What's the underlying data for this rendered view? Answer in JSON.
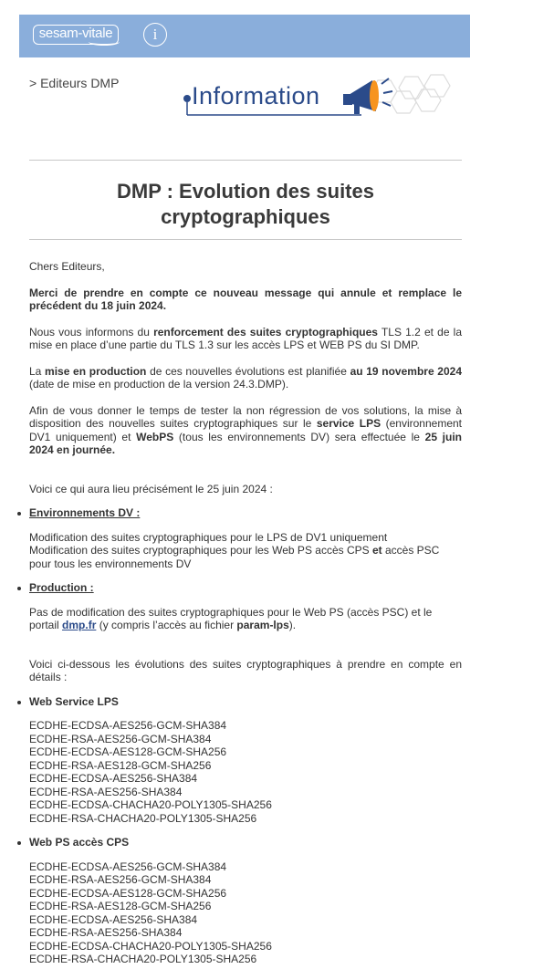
{
  "header": {
    "logo_text": "sesam-vitale",
    "info_icon": "i"
  },
  "breadcrumb": "> Editeurs DMP",
  "graphic": {
    "word": "Information",
    "icon": "megaphone-icon"
  },
  "title_line1": "DMP : Evolution des suites",
  "title_line2": "cryptographiques",
  "greeting": "Chers Editeurs,",
  "p1": "Merci de prendre en compte ce nouveau message qui annule et remplace le précédent du 18 juin 2024.",
  "p2": {
    "a": "Nous vous informons du ",
    "b": "renforcement des suites cryptographiques",
    "c": " TLS 1.2 et de la mise en place d’une partie du TLS 1.3 sur les accès LPS et WEB PS du SI DMP."
  },
  "p3": {
    "a": "La ",
    "b": "mise en production",
    "c": " de ces nouvelles évolutions est planifiée ",
    "d": "au 19 novembre 2024",
    "e": " (date de mise en production de la version 24.3.DMP)."
  },
  "p4": {
    "a": "Afin de vous donner le temps de tester la non régression de vos solutions, la mise à disposition des nouvelles suites cryptographiques sur le ",
    "b": "service LPS",
    "c": " (environnement DV1 uniquement) et ",
    "d": "WebPS",
    "e": " (tous les environnements DV) sera effectuée le ",
    "f": "25 juin 2024 en journée."
  },
  "p5": "Voici ce qui aura lieu précisément le 25 juin 2024 :",
  "section_dv": {
    "heading": "Environnements DV :",
    "line1": "Modification des suites cryptographiques pour le LPS de DV1 uniquement",
    "line2a": "Modification des suites cryptographiques pour les Web PS accès CPS ",
    "line2b": "et",
    "line2c": " accès PSC pour tous les environnements DV"
  },
  "section_prod": {
    "heading": "Production :",
    "a": "Pas de modification des suites cryptographiques pour le Web PS (accès PSC) et le portail ",
    "link": "dmp.fr",
    "b": " (y compris l’accès au fichier ",
    "c": "param-lps",
    "d": ")."
  },
  "p6": "Voici ci-dessous les évolutions des suites cryptographiques à prendre en compte en détails :",
  "lps": {
    "heading": "Web Service LPS",
    "suites": [
      "ECDHE-ECDSA-AES256-GCM-SHA384",
      "ECDHE-RSA-AES256-GCM-SHA384",
      "ECDHE-ECDSA-AES128-GCM-SHA256",
      "ECDHE-RSA-AES128-GCM-SHA256",
      "ECDHE-ECDSA-AES256-SHA384",
      "ECDHE-RSA-AES256-SHA384",
      "ECDHE-ECDSA-CHACHA20-POLY1305-SHA256",
      "ECDHE-RSA-CHACHA20-POLY1305-SHA256"
    ]
  },
  "cps": {
    "heading": "Web PS accès CPS",
    "suites": [
      "ECDHE-ECDSA-AES256-GCM-SHA384",
      "ECDHE-RSA-AES256-GCM-SHA384",
      "ECDHE-ECDSA-AES128-GCM-SHA256",
      "ECDHE-RSA-AES128-GCM-SHA256",
      "ECDHE-ECDSA-AES256-SHA384",
      "ECDHE-RSA-AES256-SHA384",
      "ECDHE-ECDSA-CHACHA20-POLY1305-SHA256",
      "ECDHE-RSA-CHACHA20-POLY1305-SHA256"
    ]
  }
}
